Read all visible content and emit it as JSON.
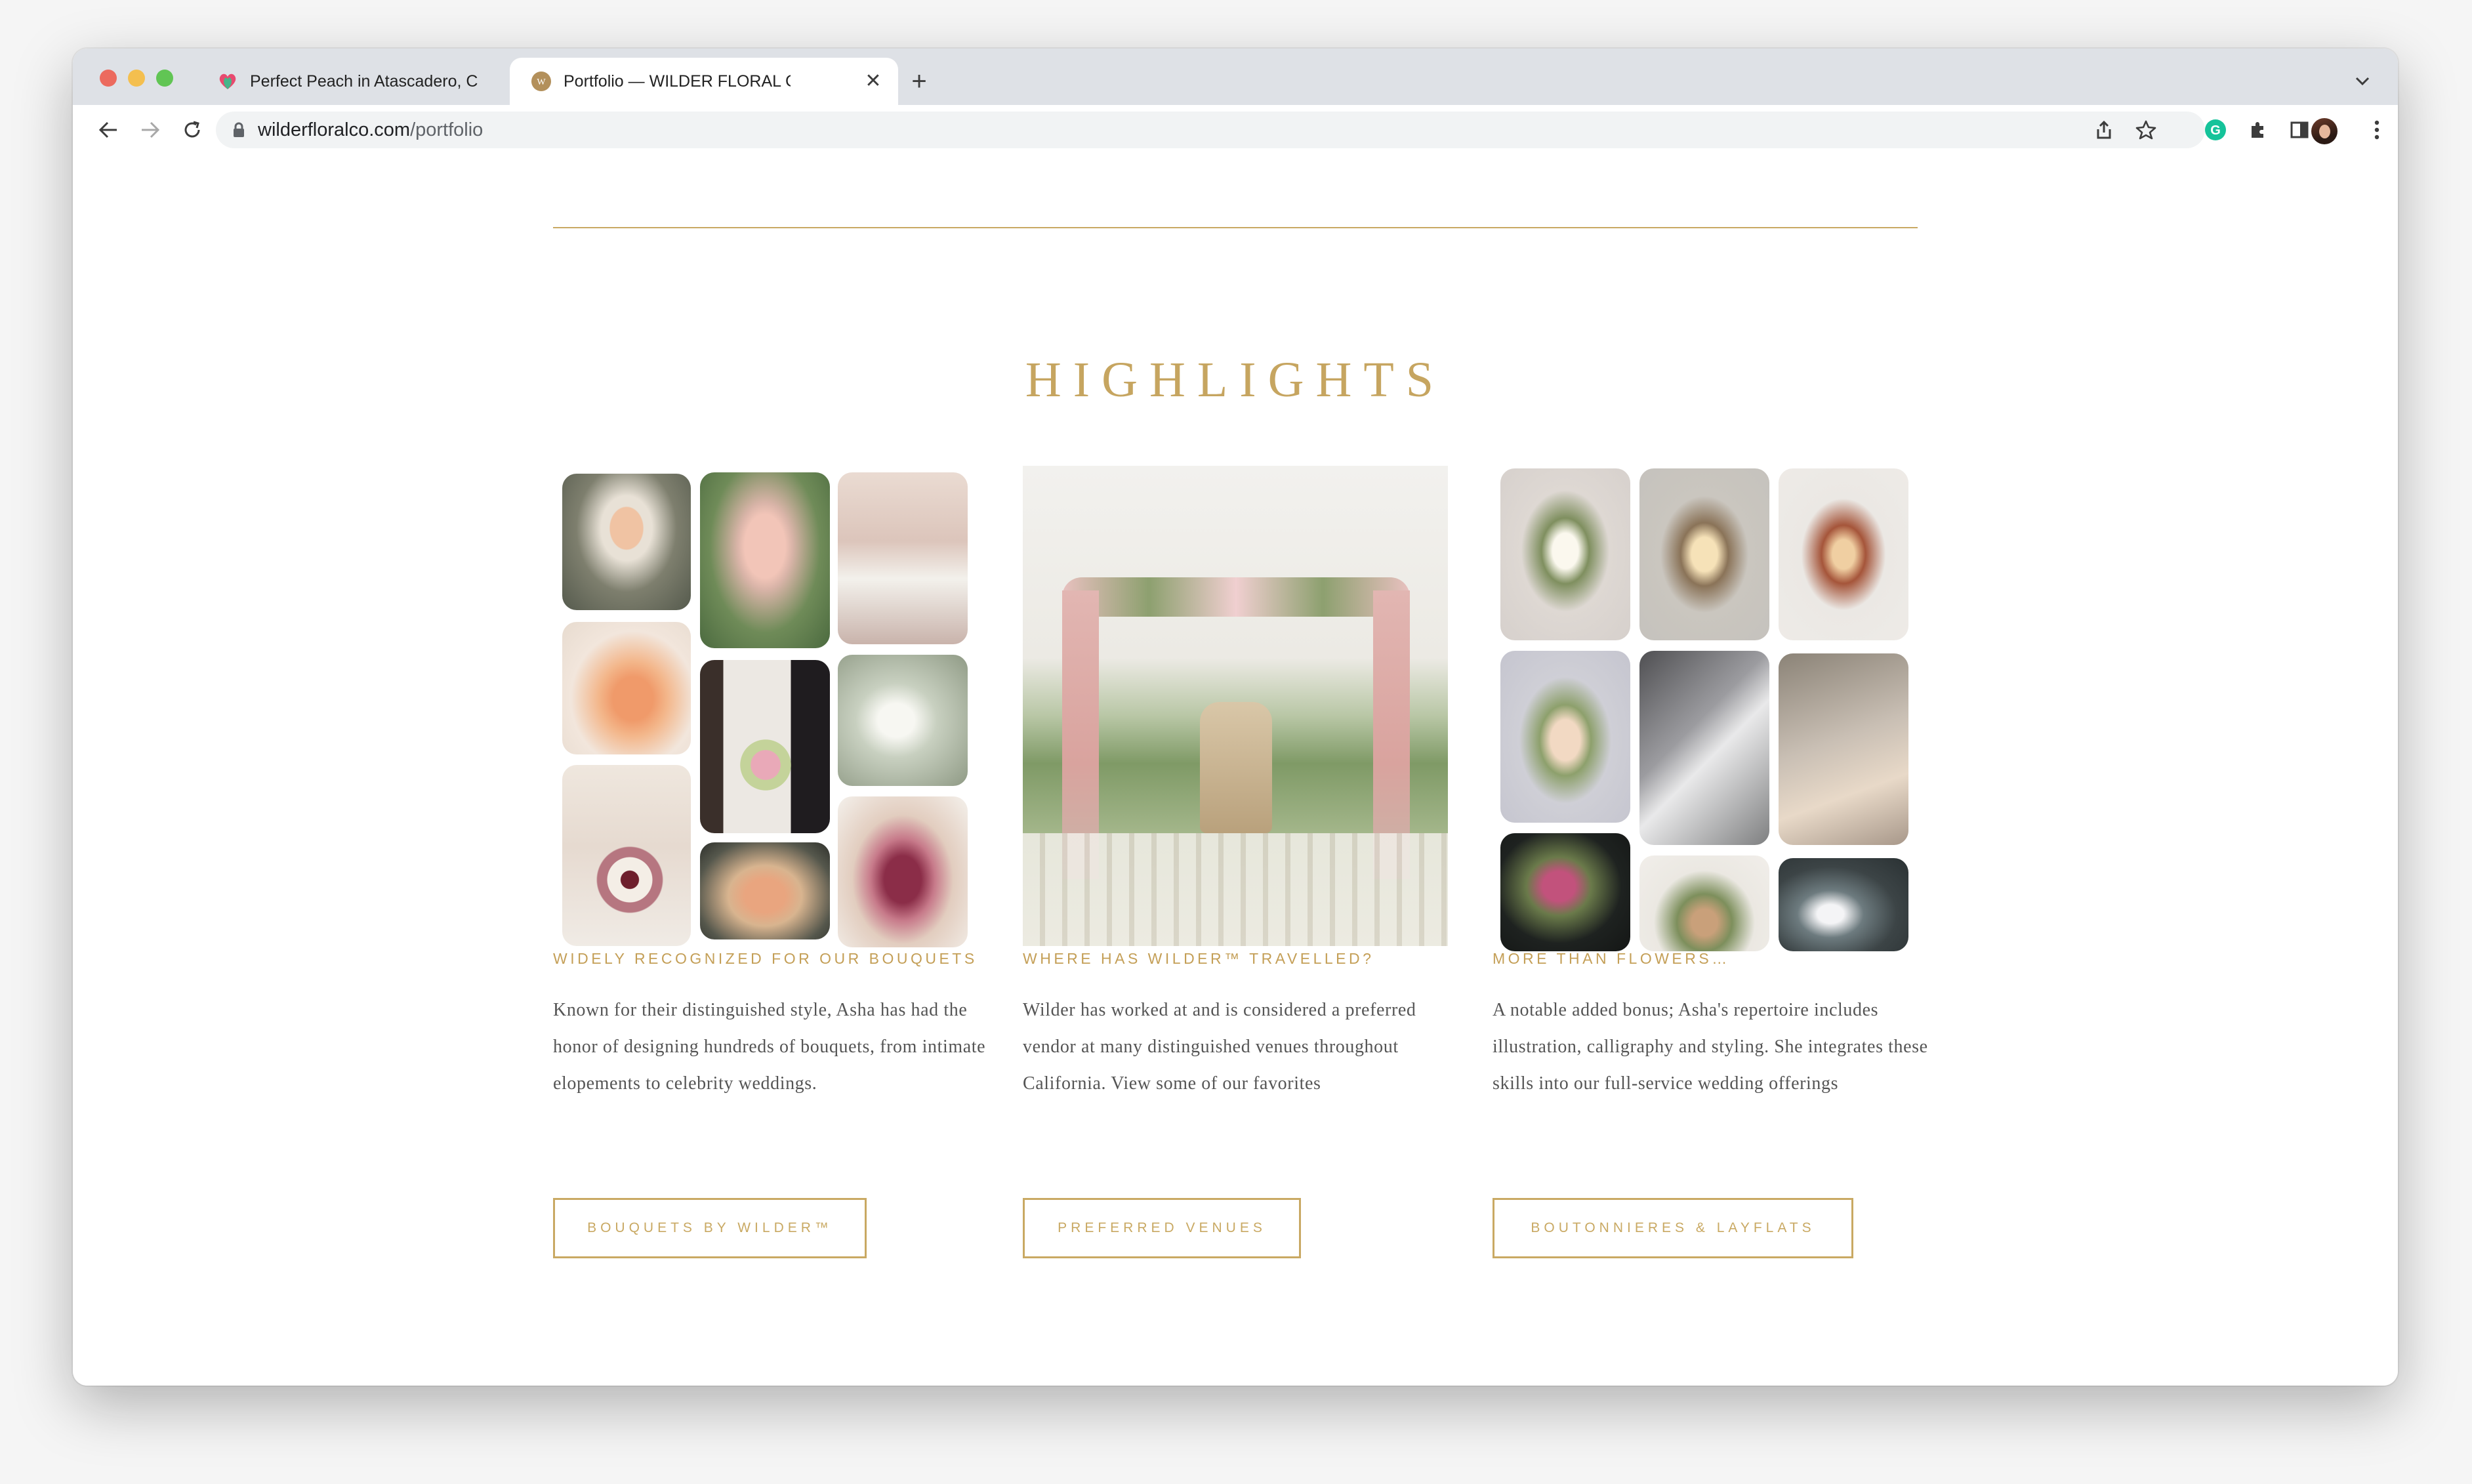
{
  "browser": {
    "tabs": [
      {
        "title": "Perfect Peach in Atascadero, C",
        "active": false
      },
      {
        "title": "Portfolio — WILDER FLORAL CO",
        "active": true
      }
    ],
    "url_host": "wilderfloralco.com",
    "url_path": "/portfolio"
  },
  "page": {
    "heading": "HIGHLIGHTS",
    "accent_color": "#c9a963",
    "columns": [
      {
        "heading": "WIDELY RECOGNIZED FOR OUR BOUQUETS",
        "text": "Known for their distinguished style, Asha has had the honor of designing hundreds of bouquets, from intimate elopements to celebrity weddings.",
        "button": "BOUQUETS BY WILDER™"
      },
      {
        "heading": "WHERE HAS WILDER™ TRAVELLED?",
        "text": "Wilder has worked at and is considered a preferred vendor at many distinguished venues throughout California. View some of our favorites",
        "button": "PREFERRED VENUES"
      },
      {
        "heading": "MORE THAN FLOWERS…",
        "text": "A notable added bonus; Asha's repertoire includes illustration, calligraphy and styling. She integrates these skills into our full-service wedding offerings",
        "button": "BOUTONNIERES & LAYFLATS"
      }
    ]
  }
}
